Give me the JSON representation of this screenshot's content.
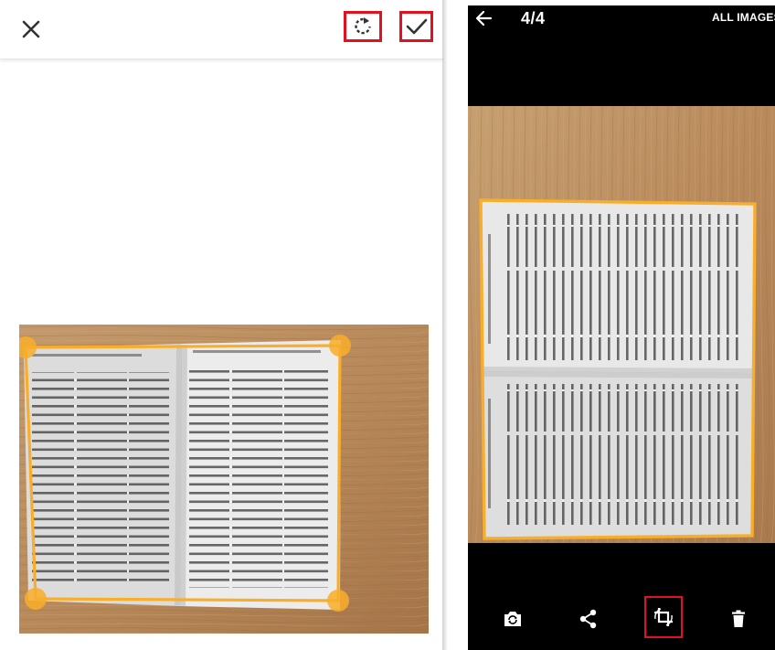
{
  "left_screen": {
    "toolbar": {
      "close_icon": "close-icon",
      "rotate_icon": "rotate-icon",
      "confirm_icon": "check-icon"
    }
  },
  "right_screen": {
    "header": {
      "back_icon": "arrow-back-icon",
      "page_counter": "4/4",
      "all_images_label": "ALL IMAGES"
    },
    "bottom_toolbar": {
      "icons": [
        "camera-switch-icon",
        "share-icon",
        "crop-icon",
        "delete-icon"
      ]
    }
  },
  "colors": {
    "crop_frame": "#f8ae2a",
    "highlight_box": "#e3101f",
    "wood": "#b98a5c"
  }
}
